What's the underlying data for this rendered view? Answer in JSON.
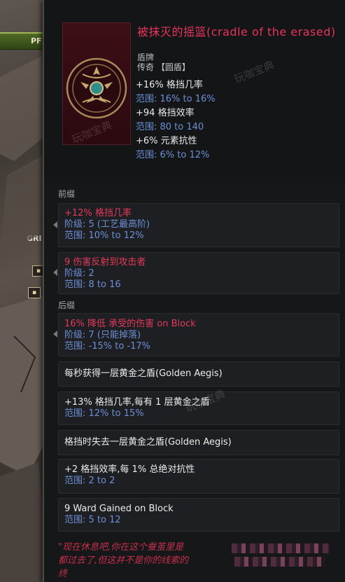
{
  "background": {
    "bar_label": "PF",
    "left_label": "GRI"
  },
  "item": {
    "title": "被抹灭的摇篮(cradle of the erased)",
    "subtype": "盾牌",
    "rarity": "传奇  【圆盾】",
    "implicits": [
      {
        "text": "+16% 格挡几率",
        "range": "范围: 16% to 16%"
      },
      {
        "text": "+94 格挡效率",
        "range": "范围: 80 to 140"
      },
      {
        "text": "+6% 元素抗性",
        "range": "范围: 6% to 12%"
      }
    ]
  },
  "sections": {
    "prefix": "前缀",
    "suffix": "后缀"
  },
  "affixes": {
    "p1": {
      "line": "+12% 格挡几率",
      "tier": "阶级: 5 (工艺最高阶)",
      "range": "范围: 10% to 12%"
    },
    "p2": {
      "line": "9 伤害反射到攻击者",
      "tier": "阶级: 2",
      "range": "范围: 8 to 16"
    },
    "s1": {
      "line": "16% 降低 承受的伤害 on Block",
      "tier": "阶级: 7 (只能掉落)",
      "range": "范围: -15% to -17%"
    }
  },
  "uniques": [
    {
      "line": "每秒获得一层黄金之盾(Golden Aegis)",
      "range": ""
    },
    {
      "line": "+13% 格挡几率,每有 1 层黄金之盾",
      "range": "范围: 12% to 15%"
    },
    {
      "line": "格挡时失去一层黄金之盾(Golden Aegis)",
      "range": ""
    },
    {
      "line": "+2 格挡效率,每 1% 总绝对抗性",
      "range": "范围: 2 to 2"
    },
    {
      "line": "9 Ward Gained on Block",
      "range": "范围: 5 to 12"
    }
  ],
  "lore": {
    "line1": "\"现在休息吧,你在这个蚕茧里是",
    "line2": "都过去了,但这并不是你的线索的",
    "line3": "终"
  },
  "watermark": "玩咖宝典",
  "colors": {
    "title": "#e8345d",
    "range": "#6d8fd6",
    "affix_red": "#e23a5a",
    "panel": "#151719"
  }
}
